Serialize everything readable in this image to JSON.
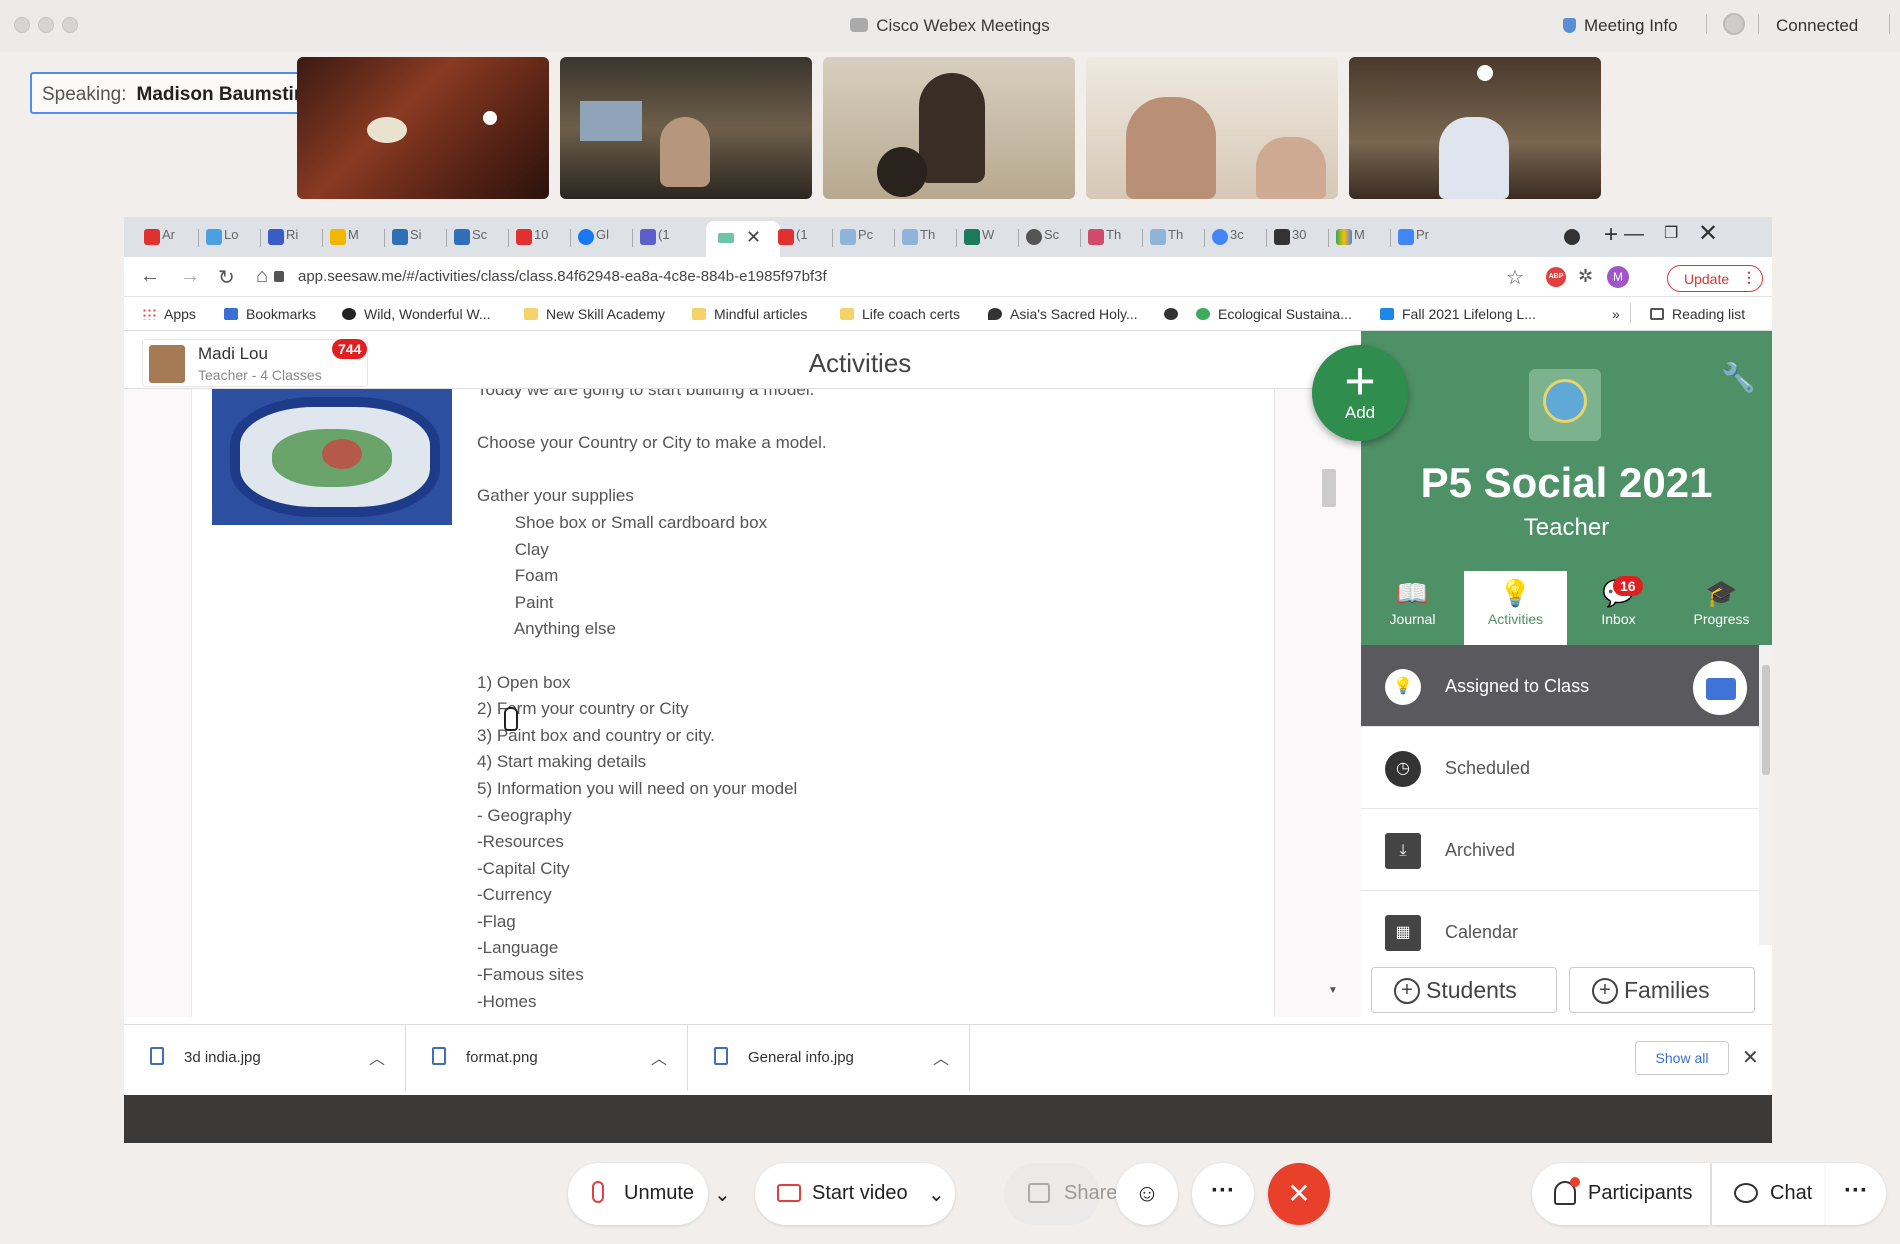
{
  "webex": {
    "app_title": "Cisco Webex Meetings",
    "meeting_info": "Meeting Info",
    "status": "Connected",
    "speaking_label": "Speaking:",
    "speaker_name": "Madison Baumstimler (Coh...",
    "controls": {
      "unmute": "Unmute",
      "start_video": "Start video",
      "share": "Share",
      "participants": "Participants",
      "chat": "Chat"
    }
  },
  "browser": {
    "tabs": [
      "Ar",
      "Lo",
      "Ri",
      "M",
      "Si",
      "Sc",
      "10",
      "Gl",
      "(1",
      "",
      "(1",
      "Pc",
      "Th",
      "W",
      "Sc",
      "Th",
      "Th",
      "3c",
      "30",
      "M",
      "Pr"
    ],
    "url": "app.seesaw.me/#/activities/class/class.84f62948-ea8a-4c8e-884b-e1985f97bf3f",
    "update_label": "Update",
    "extension_abp": "ABP",
    "profile_initial": "M",
    "bookmarks": [
      "Apps",
      "Bookmarks",
      "Wild, Wonderful W...",
      "New Skill Academy",
      "Mindful articles",
      "Life coach certs",
      "Asia's Sacred Holy...",
      "",
      "Ecological Sustaina...",
      "Fall 2021 Lifelong L..."
    ],
    "reading_list": "Reading list",
    "overflow": "»"
  },
  "seesaw": {
    "user_name": "Madi Lou",
    "user_role": "Teacher - 4 Classes",
    "notification_count": "744",
    "page_title": "Activities",
    "add_label": "Add",
    "activity_text": "Today we are going to start building a model.\n\nChoose your Country or City to make a model.\n\nGather your supplies\n        Shoe box or Small cardboard box\n        Clay\n        Foam\n        Paint\n        Anything else\n\n1) Open box\n2) Form your country or City\n3) Paint box and country or city.\n4) Start making details\n5) Information you will need on your model\n- Geography\n-Resources\n-Capital City\n-Currency\n-Flag\n-Language\n-Famous sites\n-Homes",
    "class_name": "P5 Social 2021",
    "class_role": "Teacher",
    "nav": {
      "journal": "Journal",
      "activities": "Activities",
      "inbox": "Inbox",
      "inbox_count": "16",
      "progress": "Progress"
    },
    "list": {
      "assigned": "Assigned to Class",
      "scheduled": "Scheduled",
      "archived": "Archived",
      "calendar": "Calendar"
    },
    "students_label": "Students",
    "families_label": "Families"
  },
  "downloads": {
    "items": [
      "3d india.jpg",
      "format.png",
      "General info.jpg"
    ],
    "show_all": "Show all"
  },
  "colors": {
    "seesaw_green": "#4f9167",
    "add_green": "#2f8d4d",
    "badge_red": "#e02020",
    "end_call_red": "#e8402a",
    "webex_blue": "#4f8ef0"
  }
}
